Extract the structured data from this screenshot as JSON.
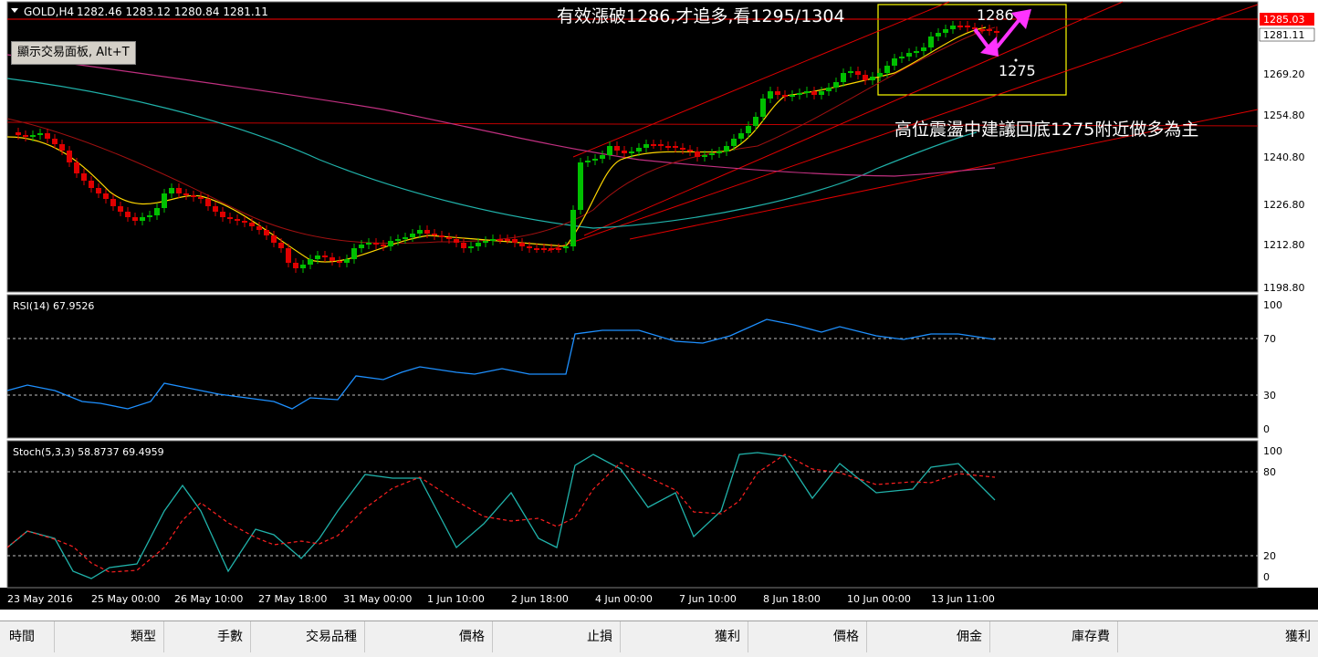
{
  "symbol_header": {
    "label": "GOLD,H4",
    "ohlc": "1282.46 1283.12 1280.84 1281.11"
  },
  "trade_panel_button": "顯示交易面板, Alt+T",
  "annotations": {
    "headline": "有效漲破1286,才追多,看1295/1304",
    "level_high": "1286",
    "level_low": "1275",
    "advice": "高位震盪中建議回底1275附近做多為主"
  },
  "price_axis": {
    "labels": [
      "1269.20",
      "1254.80",
      "1240.80",
      "1226.80",
      "1212.80",
      "1198.80"
    ],
    "current_ask": "1285.03",
    "current_bid": "1281.11"
  },
  "rsi_panel": {
    "label": "RSI(14) 67.9526",
    "axis_labels": [
      "100",
      "70",
      "30",
      "0"
    ]
  },
  "stoch_panel": {
    "label": "Stoch(5,3,3) 58.8737 69.4959",
    "axis_labels": [
      "100",
      "80",
      "20",
      "0"
    ]
  },
  "time_axis": {
    "labels": [
      "23 May 2016",
      "25 May 00:00",
      "26 May 10:00",
      "27 May 18:00",
      "31 May 00:00",
      "1 Jun 10:00",
      "2 Jun 18:00",
      "4 Jun 00:00",
      "7 Jun 10:00",
      "8 Jun 18:00",
      "10 Jun 00:00",
      "13 Jun 11:00"
    ]
  },
  "terminal_columns": [
    "時間",
    "類型",
    "手數",
    "交易品種",
    "價格",
    "止損",
    "獲利",
    "價格",
    "佣金",
    "庫存費",
    "獲利"
  ],
  "colors": {
    "background": "#000000",
    "bull_candle": "#00c000",
    "bear_candle": "#e00000",
    "rsi_line": "#1e90ff",
    "stoch_main": "#20b2aa",
    "stoch_signal": "#ff2020",
    "channel": "#e00000",
    "highlight_box": "#ffff00",
    "arrow": "#ff33ff"
  }
}
